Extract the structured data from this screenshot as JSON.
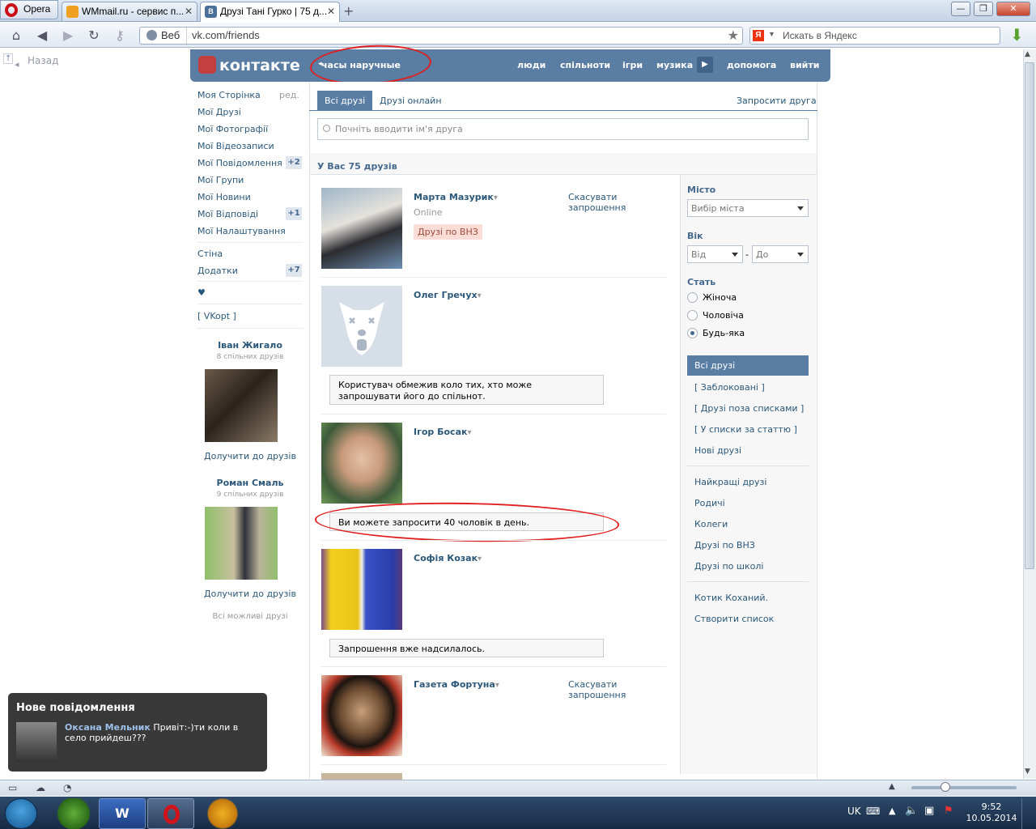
{
  "browser": {
    "menu_label": "Opera",
    "tabs": [
      {
        "title": "WMmail.ru - сервис п..."
      },
      {
        "title": "Друзі Тані Гурко | 75 д..."
      }
    ],
    "address": {
      "web_label": "Веб",
      "url": "vk.com/friends"
    },
    "search_placeholder": "Искать в Яндекс",
    "back_label": "Назад"
  },
  "vk_header": {
    "logo_text": "контакте",
    "search_tag": "часы наручные",
    "nav": [
      "люди",
      "спільноти",
      "ігри",
      "музика",
      "допомога",
      "вийти"
    ]
  },
  "left_menu": {
    "items": [
      {
        "label": "Моя Сторінка",
        "extra": "ред."
      },
      {
        "label": "Мої Друзі"
      },
      {
        "label": "Мої Фотографії"
      },
      {
        "label": "Мої Відеозаписи"
      },
      {
        "label": "Мої Повідомлення",
        "count": "+2"
      },
      {
        "label": "Мої Групи"
      },
      {
        "label": "Мої Новини"
      },
      {
        "label": "Мої Відповіді",
        "count": "+1"
      },
      {
        "label": "Мої Налаштування"
      }
    ],
    "extra_items": [
      {
        "label": "Стіна"
      },
      {
        "label": "Додатки",
        "count": "+7"
      }
    ],
    "heart": "♥",
    "vkopt": "[ VKopt ]",
    "suggestions": [
      {
        "name": "Іван Жигало",
        "mutual": "8 спільних друзів",
        "add": "Долучити до друзів"
      },
      {
        "name": "Роман Смаль",
        "mutual": "9 спільних друзів",
        "add": "Долучити до друзів"
      }
    ],
    "all_possible": "Всі можливі друзі"
  },
  "friends_page": {
    "tabs": [
      "Всі друзі",
      "Друзі онлайн"
    ],
    "invite": "Запросити друга",
    "search_placeholder": "Почніть вводити ім'я друга",
    "count_text": "У Вас 75 друзів",
    "friends": [
      {
        "name": "Марта Мазурик",
        "status": "Online",
        "badge": "Друзі по ВНЗ",
        "action": "Скасувати запрошення"
      },
      {
        "name": "Олег Гречух",
        "message": "Користувач обмежив коло тих, хто може запрошувати його до спільнот."
      },
      {
        "name": "Ігор Босак",
        "message": "Ви можете запросити 40 чоловік в день."
      },
      {
        "name": "Софія Козак",
        "message": "Запрошення вже надсилалось."
      },
      {
        "name": "Газета Фортуна",
        "action": "Скасувати запрошення"
      }
    ],
    "dropdown_arrow": "▾"
  },
  "filter": {
    "city_label": "Місто",
    "city_select": "Вибір міста",
    "age_label": "Вік",
    "age_from": "Від",
    "age_dash": "-",
    "age_to": "До",
    "sex_label": "Стать",
    "sex_options": [
      {
        "label": "Жіноча",
        "checked": false
      },
      {
        "label": "Чоловіча",
        "checked": false
      },
      {
        "label": "Будь-яка",
        "checked": true
      }
    ],
    "lists": [
      "Всі друзі",
      "[ Заблоковані ]",
      "[ Друзі поза списками ]",
      "[ У списки за статтю ]",
      "Нові друзі"
    ],
    "lists2": [
      "Найкращі друзі",
      "Родичі",
      "Колеги",
      "Друзі по ВНЗ",
      "Друзі по школі"
    ],
    "lists3": [
      "Котик Коханий.",
      "Створити список"
    ]
  },
  "notification": {
    "title": "Нове повідомлення",
    "sender": "Оксана Мельник",
    "text": "Привіт:-)ти коли в село прийдеш???"
  },
  "taskbar": {
    "lang": "UK",
    "time": "9:52",
    "date": "10.05.2014"
  },
  "colors": {
    "vk_blue": "#597da3",
    "link": "#2b587a",
    "annotation_red": "#e02020",
    "opera_red": "#cc0f16"
  }
}
